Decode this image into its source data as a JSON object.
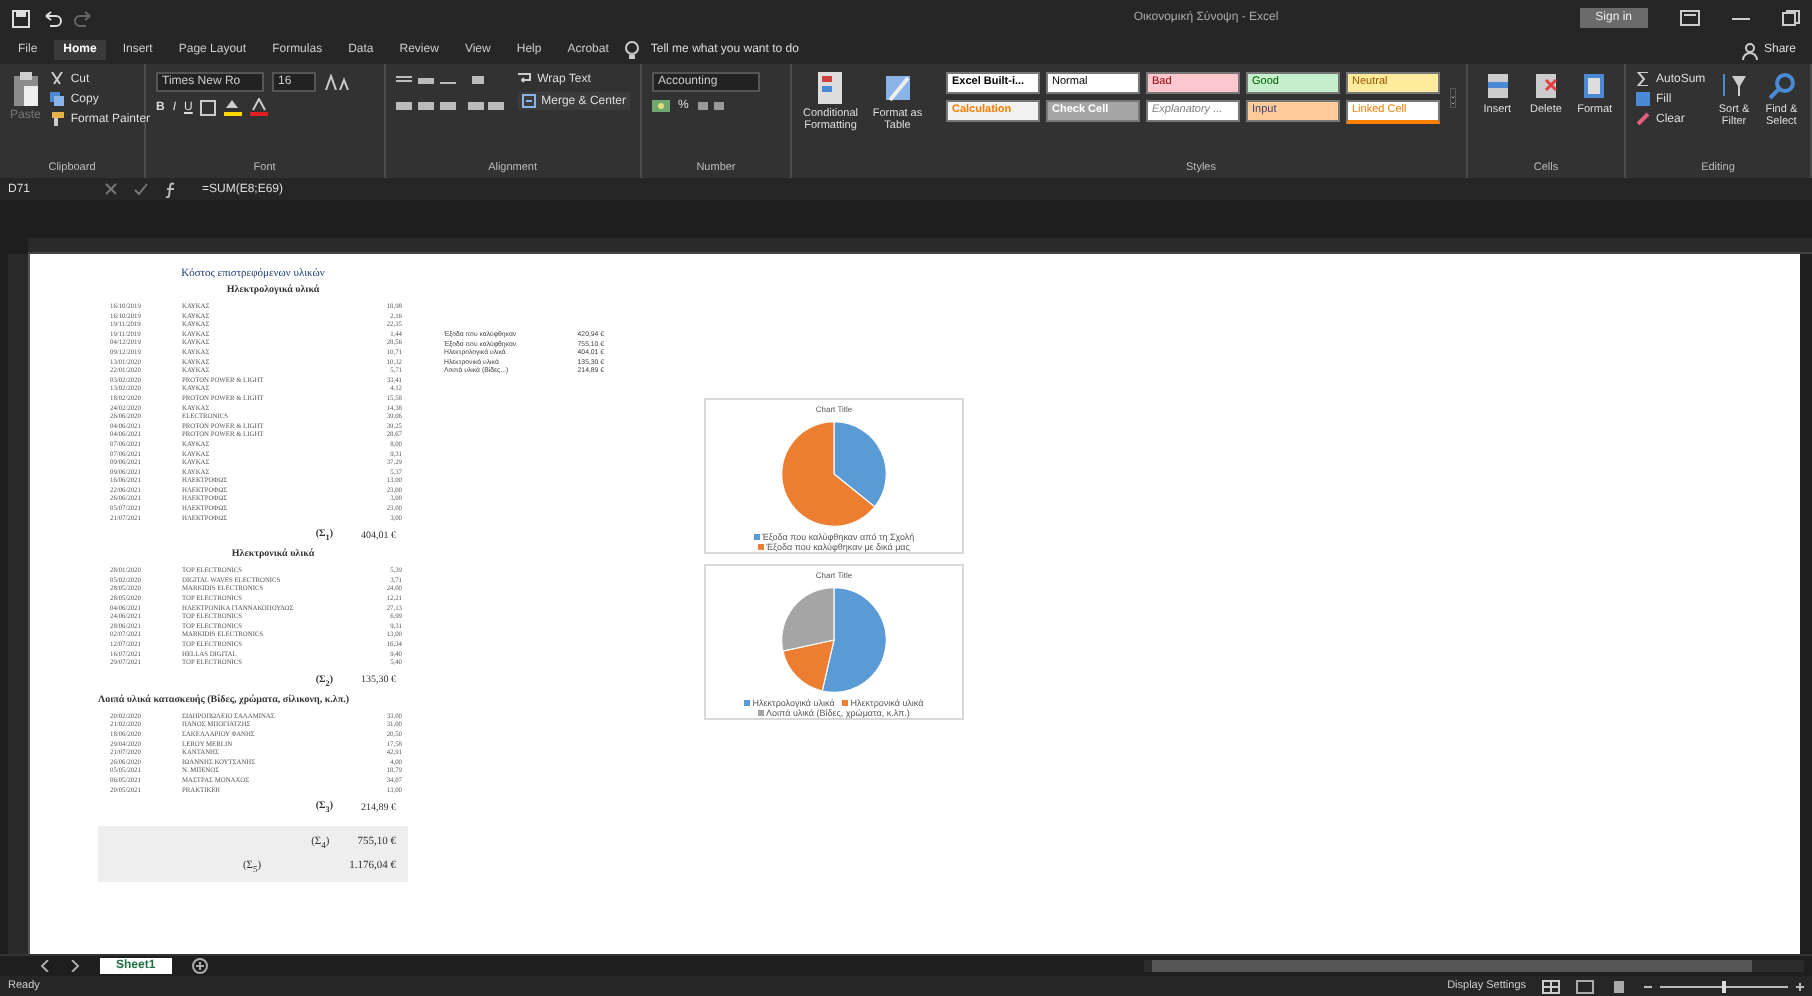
{
  "window": {
    "title": "Οικονομική Σύνοψη - Excel",
    "sign_in": "Sign in",
    "share": "Share"
  },
  "menu_tabs": [
    {
      "label": "File",
      "selected": false
    },
    {
      "label": "Home",
      "selected": true
    },
    {
      "label": "Insert",
      "selected": false
    },
    {
      "label": "Page Layout",
      "selected": false
    },
    {
      "label": "Formulas",
      "selected": false
    },
    {
      "label": "Data",
      "selected": false
    },
    {
      "label": "Review",
      "selected": false
    },
    {
      "label": "View",
      "selected": false
    },
    {
      "label": "Help",
      "selected": false
    },
    {
      "label": "Acrobat",
      "selected": false
    }
  ],
  "tell_me": "Tell me what you want to do",
  "ribbon": {
    "clipboard": {
      "paste": "Paste",
      "cut": "Cut",
      "copy": "Copy",
      "format_painter": "Format Painter",
      "label": "Clipboard"
    },
    "font": {
      "family": "Times New Ro",
      "size": "16",
      "bold": "B",
      "italic": "I",
      "underline": "U",
      "label": "Font"
    },
    "alignment": {
      "wrap": "Wrap Text",
      "merge": "Merge & Center",
      "label": "Alignment"
    },
    "number": {
      "format": "Accounting",
      "percent": "%",
      "label": "Number"
    },
    "conditional": "Conditional Formatting",
    "format_table": "Format as Table",
    "styles": [
      {
        "label": "Excel Built-i...",
        "kind": "plain"
      },
      {
        "label": "Normal",
        "kind": "normal"
      },
      {
        "label": "Bad",
        "kind": "bad"
      },
      {
        "label": "Good",
        "kind": "good"
      },
      {
        "label": "Neutral",
        "kind": "neutral"
      },
      {
        "label": "Calculation",
        "kind": "calculation"
      },
      {
        "label": "Check Cell",
        "kind": "check"
      },
      {
        "label": "Explanatory ...",
        "kind": "explanatory"
      },
      {
        "label": "Input",
        "kind": "input"
      },
      {
        "label": "Linked Cell",
        "kind": "linked"
      }
    ],
    "styles_label": "Styles",
    "cells": {
      "insert": "Insert",
      "delete": "Delete",
      "format": "Format",
      "label": "Cells"
    },
    "editing": {
      "autosum": "AutoSum",
      "fill": "Fill",
      "clear": "Clear",
      "sort": "Sort & Filter",
      "find": "Find & Select",
      "label": "Editing"
    }
  },
  "formula_bar": {
    "name_box": "D71",
    "formula": "=SUM(E8;E69)"
  },
  "sheet": {
    "title": "Κόστος επιστρεφόμενων υλικών",
    "sections": [
      {
        "heading": "Ηλεκτρολογικά υλικά",
        "total_label": "(Σ$_{1}$)",
        "total": "404,01 €",
        "rows": [
          [
            "16/10/2019",
            "ΚΑΥΚΑΣ",
            "18,98"
          ],
          [
            "16/10/2019",
            "ΚΑΥΚΑΣ",
            "2,16"
          ],
          [
            "19/11/2019",
            "ΚΑΥΚΑΣ",
            "22,35"
          ],
          [
            "19/11/2019",
            "ΚΑΥΚΑΣ",
            "1,44"
          ],
          [
            "04/12/2019",
            "ΚΑΥΚΑΣ",
            "28,56"
          ],
          [
            "09/12/2019",
            "ΚΑΥΚΑΣ",
            "10,71"
          ],
          [
            "13/01/2020",
            "ΚΑΥΚΑΣ",
            "10,32"
          ],
          [
            "22/01/2020",
            "ΚΑΥΚΑΣ",
            "5,71"
          ],
          [
            "03/02/2020",
            "PROTON POWER & LIGHT",
            "33,41"
          ],
          [
            "13/02/2020",
            "ΚΑΥΚΑΣ",
            "4,12"
          ],
          [
            "18/02/2020",
            "PROTON POWER & LIGHT",
            "15,58"
          ],
          [
            "24/02/2020",
            "ΚΑΥΚΑΣ",
            "14,38"
          ],
          [
            "26/06/2020",
            "ELECTRONICS",
            "39,06"
          ],
          [
            "04/06/2021",
            "PROTON POWER & LIGHT",
            "39,25"
          ],
          [
            "04/06/2021",
            "PROTON POWER & LIGHT",
            "28,67"
          ],
          [
            "07/06/2021",
            "ΚΑΥΚΑΣ",
            "8,00"
          ],
          [
            "07/06/2021",
            "ΚΑΥΚΑΣ",
            "9,31"
          ],
          [
            "09/06/2021",
            "ΚΑΥΚΑΣ",
            "37,29"
          ],
          [
            "09/06/2021",
            "ΚΑΥΚΑΣ",
            "5,37"
          ],
          [
            "16/06/2021",
            "ΗΛΕΚΤΡΟΦΩΣ",
            "13,00"
          ],
          [
            "22/06/2021",
            "ΗΛΕΚΤΡΟΦΩΣ",
            "23,00"
          ],
          [
            "26/06/2021",
            "ΗΛΕΚΤΡΟΦΩΣ",
            "3,00"
          ],
          [
            "05/07/2021",
            "ΗΛΕΚΤΡΟΦΩΣ",
            "23,00"
          ],
          [
            "21/07/2021",
            "ΗΛΕΚΤΡΟΦΩΣ",
            "3,00"
          ]
        ]
      },
      {
        "heading": "Ηλεκτρονικά υλικά",
        "total_label": "(Σ$_{2}$)",
        "total": "135,30 €",
        "rows": [
          [
            "28/01/2020",
            "TOP ELECTRONICS",
            "5,39"
          ],
          [
            "05/02/2020",
            "DIGITAL WAVES ELECTRONICS",
            "3,71"
          ],
          [
            "28/05/2020",
            "MARKIDIS ELECTRONICS",
            "24,00"
          ],
          [
            "28/05/2020",
            "TOP ELECTRONICS",
            "12,21"
          ],
          [
            "04/06/2021",
            "ΗΛΕΚΤΡΟΝΙΚΑ ΓΙΑΝΝΑΚΟΠΟΥΛΟΣ",
            "27,13"
          ],
          [
            "24/06/2021",
            "TOP ELECTRONICS",
            "6,99"
          ],
          [
            "28/06/2021",
            "TOP ELECTRONICS",
            "9,31"
          ],
          [
            "02/07/2021",
            "MARKIDIS ELECTRONICS",
            "13,00"
          ],
          [
            "12/07/2021",
            "TOP ELECTRONICS",
            "16,34"
          ],
          [
            "16/07/2021",
            "HELLAS DIGITAL",
            "9,40"
          ],
          [
            "29/07/2021",
            "TOP ELECTRONICS",
            "5,40"
          ]
        ]
      },
      {
        "heading": "Λοιπά υλικά κατασκευής (Βίδες, χρώματα, σίλικονη, κ.λπ.)",
        "total_label": "(Σ$_{3}$)",
        "total": "214,89 €",
        "rows": [
          [
            "20/02/2020",
            "ΣΙΔΗΡΟΠΩΛΕΙΟ ΣΑΛΑΜΙΝΑΣ",
            "33,00"
          ],
          [
            "21/02/2020",
            "ΠΑΝΟΣ ΜΠΟΓΙΑΤΖΗΣ",
            "31,00"
          ],
          [
            "18/06/2020",
            "ΣΑΚΕΛΛΑΡΙΟΥ ΦΑΝΗΣ",
            "20,50"
          ],
          [
            "29/04/2020",
            "LEROY MERLIN",
            "17,58"
          ],
          [
            "21/07/2020",
            "ΚΑΝΤΑΝΗΣ",
            "42,91"
          ],
          [
            "26/06/2020",
            "ΙΩΑΝΝΗΣ ΚΟΥΤΣΑΝΗΣ",
            "4,00"
          ],
          [
            "05/05/2021",
            "Ν. ΜΠΕΝΟΣ",
            "18,79"
          ],
          [
            "06/05/2021",
            "ΜΑΣΤΡΑΣ ΜΟΝΑΧΟΣ",
            "34,07"
          ],
          [
            "20/05/2021",
            "PRAKTIKER",
            "13,00"
          ]
        ]
      }
    ],
    "grand_totals": [
      {
        "label": "(Σ$_{4}$)",
        "value": "755,10 €"
      },
      {
        "label": "(Σ$_{5}$)",
        "value": "1.176,04 €"
      }
    ],
    "summary": [
      [
        "Έξοδα που καλύφθηκαν",
        "420,94 €"
      ],
      [
        "Έξοδα που καλύφθηκαν",
        "755,10 €"
      ],
      [
        "Ηλεκτρολογικά υλικά",
        "404,01 €"
      ],
      [
        "Ηλεκτρονικά υλικά",
        "135,30 €"
      ],
      [
        "Λοιπά υλικά (Βίδες...)",
        "214,89 €"
      ]
    ],
    "charts": [
      {
        "title": "Chart Title",
        "legend": [
          {
            "label": "Έξοδα που καλύφθηκαν από τη Σχολή",
            "color": "#5b9bd5"
          },
          {
            "label": "Έξοδα που καλύφθηκαν με δικά μας",
            "color": "#ed7d31"
          }
        ]
      },
      {
        "title": "Chart Title",
        "legend": [
          {
            "label": "Ηλεκτρολογικά υλικά",
            "color": "#5b9bd5"
          },
          {
            "label": "Ηλεκτρονικά υλικά",
            "color": "#ed7d31"
          },
          {
            "label": "Λοιπά υλικά (Βίδες, χρώματα, κ.λπ.)",
            "color": "#a5a5a5"
          }
        ]
      }
    ]
  },
  "sheet_tabs": [
    {
      "label": "Sheet1",
      "selected": true
    }
  ],
  "status_bar": {
    "state": "Ready",
    "display_settings": "Display Settings",
    "zoom": {
      "level": 0.5
    }
  }
}
